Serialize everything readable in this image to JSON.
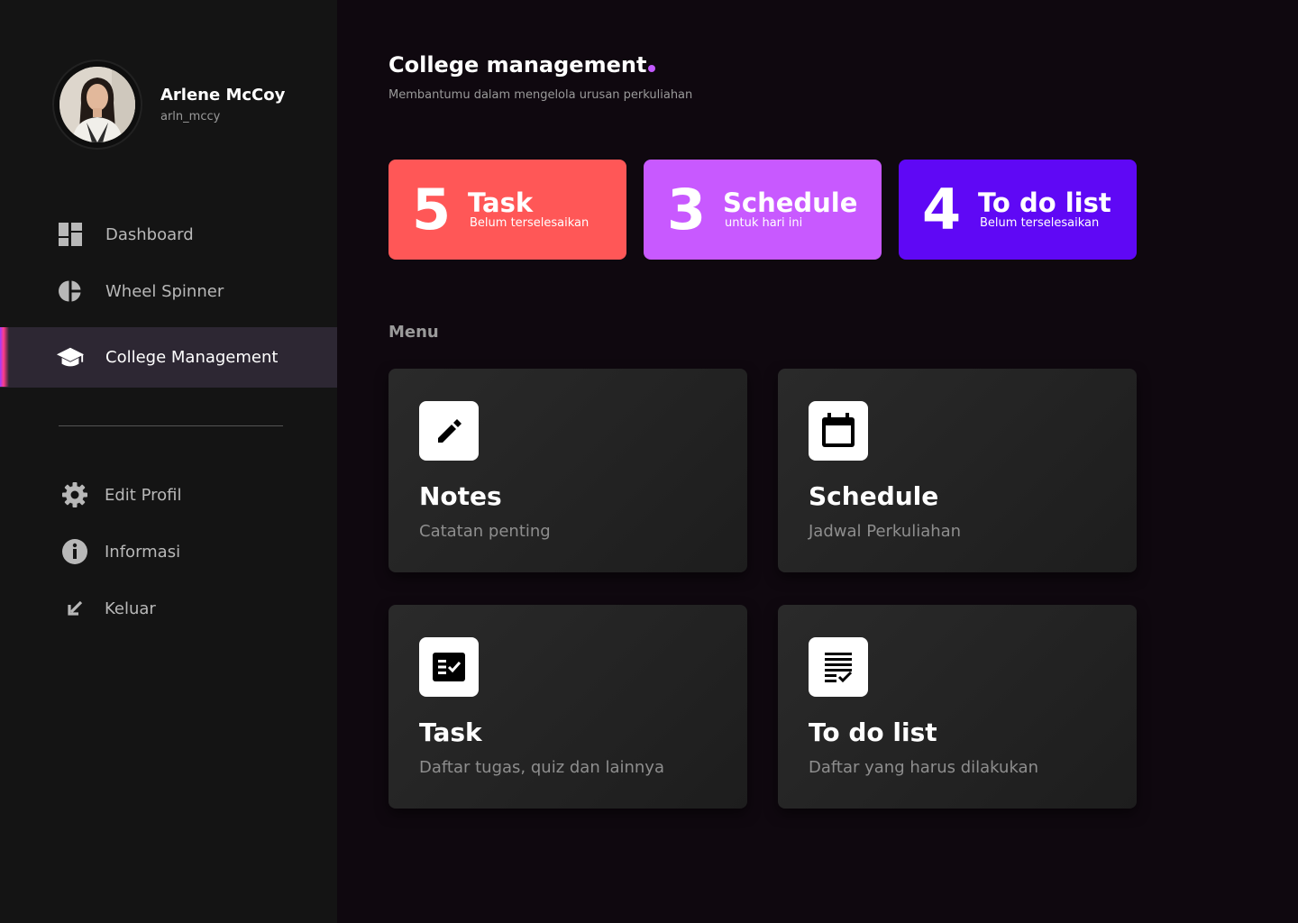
{
  "profile": {
    "name": "Arlene McCoy",
    "handle": "arln_mccy"
  },
  "nav": {
    "dashboard": "Dashboard",
    "wheel_spinner": "Wheel Spinner",
    "college_management": "College Management",
    "edit_profil": "Edit Profil",
    "informasi": "Informasi",
    "keluar": "Keluar"
  },
  "header": {
    "title": "College management",
    "subtitle": "Membantumu dalam mengelola urusan perkuliahan"
  },
  "stats": [
    {
      "count": "5",
      "title": "Task",
      "sub": "Belum terselesaikan",
      "color": "#ff5757"
    },
    {
      "count": "3",
      "title": "Schedule",
      "sub": "untuk hari ini",
      "color": "#c859ff"
    },
    {
      "count": "4",
      "title": "To do list",
      "sub": "Belum terselesaikan",
      "color": "#5f08f5"
    }
  ],
  "menu": {
    "label": "Menu",
    "cards": [
      {
        "title": "Notes",
        "sub": "Catatan penting",
        "icon": "pencil-icon"
      },
      {
        "title": "Schedule",
        "sub": "Jadwal Perkuliahan",
        "icon": "calendar-icon"
      },
      {
        "title": "Task",
        "sub": "Daftar tugas, quiz dan lainnya",
        "icon": "task-checklist-icon"
      },
      {
        "title": "To do list",
        "sub": "Daftar yang harus dilakukan",
        "icon": "todo-list-icon"
      }
    ]
  },
  "colors": {
    "accent": "#c259ff",
    "sidebar": "#141414",
    "background": "#0f080f",
    "active_nav": "#2d2733"
  }
}
